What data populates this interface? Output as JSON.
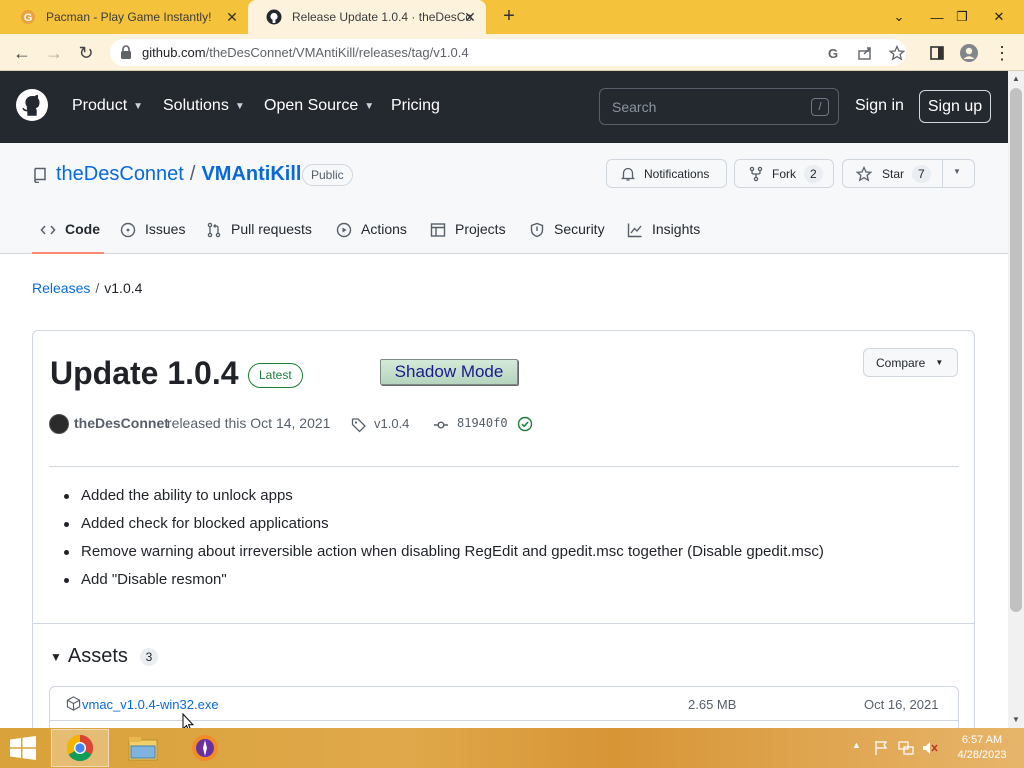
{
  "browser": {
    "tabs": [
      {
        "title": "Pacman - Play Game Instantly!",
        "active": false
      },
      {
        "title": "Release Update 1.0.4 · theDesCo",
        "active": true
      }
    ],
    "url_host": "github.com",
    "url_path": "/theDesConnet/VMAntiKill/releases/tag/v1.0.4"
  },
  "github_header": {
    "nav": [
      "Product",
      "Solutions",
      "Open Source",
      "Pricing"
    ],
    "search_placeholder": "Search",
    "search_key": "/",
    "sign_in": "Sign in",
    "sign_up": "Sign up"
  },
  "repo": {
    "owner": "theDesConnet",
    "separator": "/",
    "name": "VMAntiKill",
    "visibility": "Public",
    "notifications_label": "Notifications",
    "fork_label": "Fork",
    "fork_count": "2",
    "star_label": "Star",
    "star_count": "7",
    "tabs": [
      "Code",
      "Issues",
      "Pull requests",
      "Actions",
      "Projects",
      "Security",
      "Insights"
    ]
  },
  "breadcrumb": {
    "releases": "Releases",
    "separator": "/",
    "current": "v1.0.4"
  },
  "release": {
    "title": "Update 1.0.4",
    "badge": "Latest",
    "overlay_button": "Shadow Mode",
    "compare_label": "Compare",
    "author": "theDesConnet",
    "released_text": "released this Oct 14, 2021",
    "tag": "v1.0.4",
    "commit": "81940f0",
    "notes": [
      "Added the ability to unlock apps",
      "Added check for blocked applications",
      "Remove warning about irreversible action when disabling RegEdit and gpedit.msc together (Disable gpedit.msc)",
      "Add \"Disable resmon\""
    ],
    "assets_label": "Assets",
    "assets_count": "3",
    "assets": [
      {
        "name": "vmac_v1.0.4-win32.exe",
        "size": "2.65 MB",
        "date": "Oct 16, 2021"
      }
    ]
  },
  "taskbar": {
    "time": "6:57 AM",
    "date": "4/28/2023"
  },
  "colors": {
    "tab_strip": "#f5c33b",
    "github_header": "#24292f",
    "link": "#0969da",
    "latest_green": "#1a7f37",
    "active_tab_underline": "#fd8c73"
  }
}
